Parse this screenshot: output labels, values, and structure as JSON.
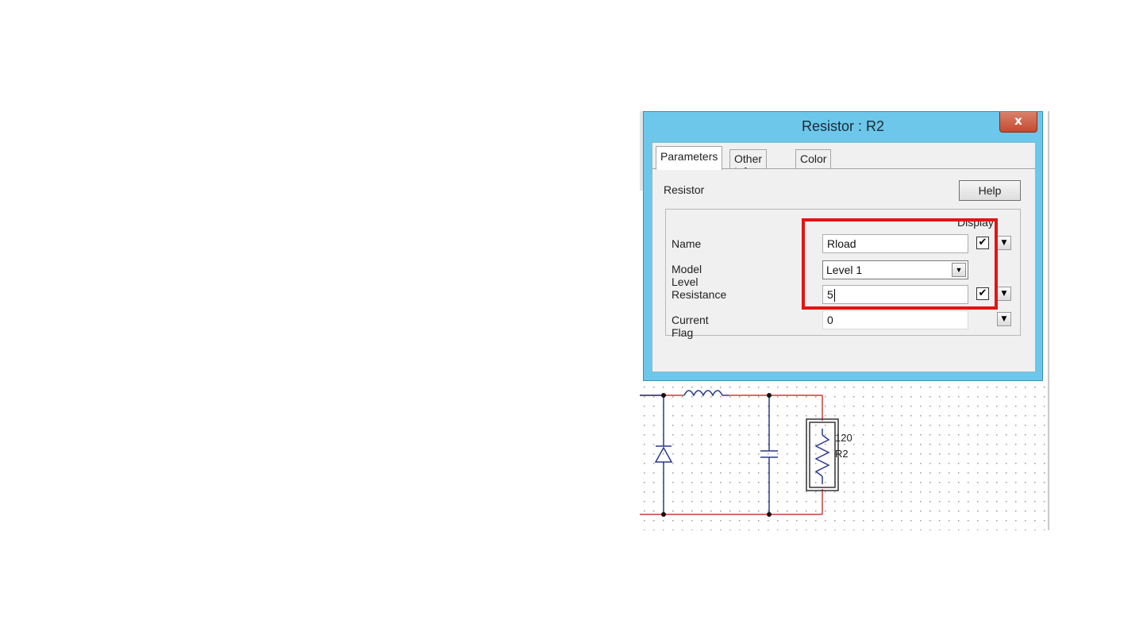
{
  "dialog": {
    "title": "Resistor : R2",
    "close_label": "x",
    "tabs": [
      {
        "label": "Parameters",
        "active": true
      },
      {
        "label": "Other Info",
        "active": false
      },
      {
        "label": "Color",
        "active": false
      }
    ],
    "section_label": "Resistor",
    "help_label": "Help",
    "display_label": "Display",
    "fields": {
      "name": {
        "label": "Name",
        "value": "Rload",
        "display_checked": true
      },
      "model_level": {
        "label": "Model Level",
        "value": "Level 1"
      },
      "resistance": {
        "label": "Resistance",
        "value": "5",
        "display_checked": true
      },
      "current_flag": {
        "label": "Current Flag",
        "value": "0"
      }
    },
    "check_glyph": "✔",
    "dropdown_glyph": "▼"
  },
  "schematic": {
    "component_value": "120",
    "component_ref": "R2"
  },
  "colors": {
    "title_bar": "#6cc7ea",
    "close_button": "#c44a2f",
    "highlight": "#e41414",
    "wire": "#d23a3a",
    "component": "#2a3a8a"
  }
}
